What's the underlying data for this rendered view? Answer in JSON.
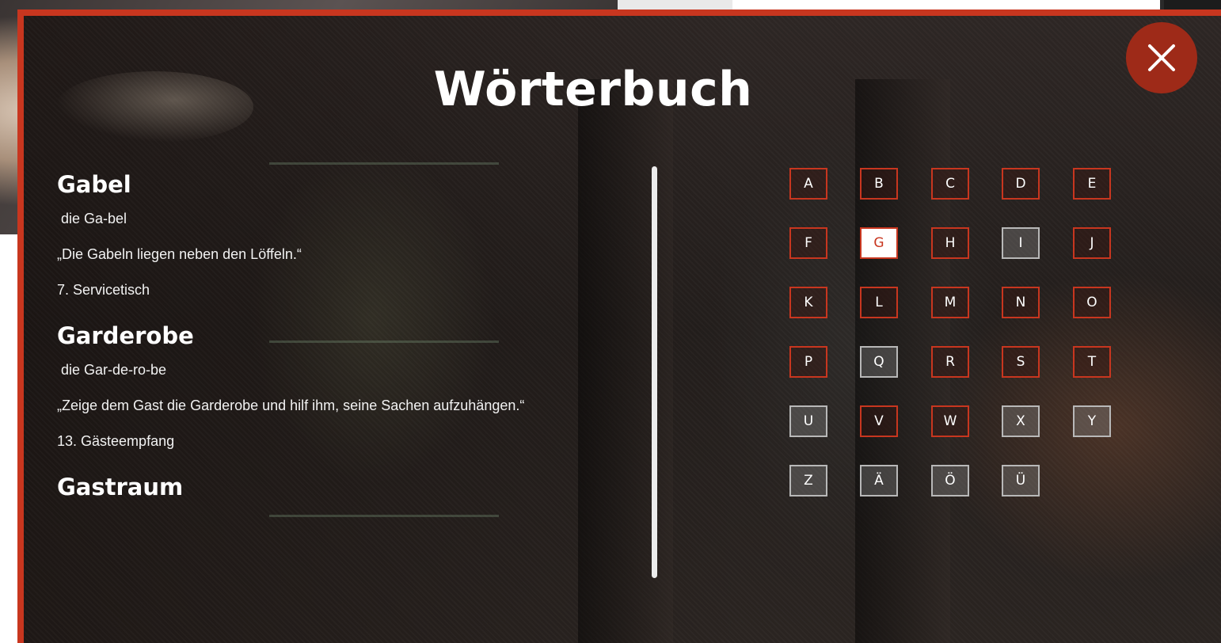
{
  "modal": {
    "title": "Wörterbuch",
    "close_icon": "close-icon"
  },
  "colors": {
    "accent": "#c8361f",
    "close_button": "#9e2a18",
    "active_letter_bg": "#ffffff",
    "disabled_letter_border": "#b8b8b8"
  },
  "entries": [
    {
      "word": "Gabel",
      "syllables": "die Ga-bel",
      "example": "„Die Gabeln liegen neben den Löffeln.“",
      "reference": "7. Servicetisch"
    },
    {
      "word": "Garderobe",
      "syllables": "die Gar-de-ro-be",
      "example": "„Zeige dem Gast die Garderobe und hilf ihm, seine Sachen aufzuhängen.“",
      "reference": "13. Gästeempfang"
    },
    {
      "word": "Gastraum"
    }
  ],
  "alphabet": {
    "selected": "G",
    "letters": [
      {
        "label": "A",
        "state": "enabled"
      },
      {
        "label": "B",
        "state": "enabled"
      },
      {
        "label": "C",
        "state": "enabled"
      },
      {
        "label": "D",
        "state": "enabled"
      },
      {
        "label": "E",
        "state": "enabled"
      },
      {
        "label": "F",
        "state": "enabled"
      },
      {
        "label": "G",
        "state": "active"
      },
      {
        "label": "H",
        "state": "enabled"
      },
      {
        "label": "I",
        "state": "disabled"
      },
      {
        "label": "J",
        "state": "enabled"
      },
      {
        "label": "K",
        "state": "enabled"
      },
      {
        "label": "L",
        "state": "enabled"
      },
      {
        "label": "M",
        "state": "enabled"
      },
      {
        "label": "N",
        "state": "enabled"
      },
      {
        "label": "O",
        "state": "enabled"
      },
      {
        "label": "P",
        "state": "enabled"
      },
      {
        "label": "Q",
        "state": "disabled"
      },
      {
        "label": "R",
        "state": "enabled"
      },
      {
        "label": "S",
        "state": "enabled"
      },
      {
        "label": "T",
        "state": "enabled"
      },
      {
        "label": "U",
        "state": "disabled"
      },
      {
        "label": "V",
        "state": "enabled"
      },
      {
        "label": "W",
        "state": "enabled"
      },
      {
        "label": "X",
        "state": "disabled"
      },
      {
        "label": "Y",
        "state": "disabled"
      },
      {
        "label": "Z",
        "state": "disabled"
      },
      {
        "label": "Ä",
        "state": "disabled"
      },
      {
        "label": "Ö",
        "state": "disabled"
      },
      {
        "label": "Ü",
        "state": "disabled"
      }
    ]
  }
}
